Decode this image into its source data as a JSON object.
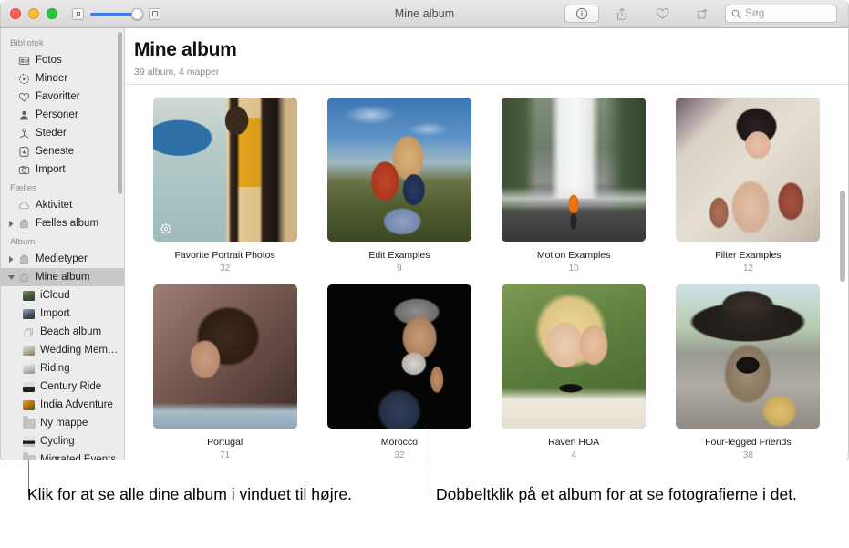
{
  "window": {
    "title": "Mine album",
    "zoom_slider_value": 100,
    "toolbar": {
      "info_label": "info-button",
      "share_label": "share-button",
      "favorite_label": "favorite-button",
      "rotate_label": "rotate-button",
      "search_placeholder": "Søg",
      "search_value": ""
    }
  },
  "sidebar": {
    "sections": [
      {
        "header": "Bibliotek",
        "items": [
          {
            "label": "Fotos",
            "icon": "photos-icon",
            "level": 0,
            "twisty": "none",
            "selected": false
          },
          {
            "label": "Minder",
            "icon": "memories-icon",
            "level": 0,
            "twisty": "none",
            "selected": false
          },
          {
            "label": "Favoritter",
            "icon": "heart-icon",
            "level": 0,
            "twisty": "none",
            "selected": false
          },
          {
            "label": "Personer",
            "icon": "person-icon",
            "level": 0,
            "twisty": "none",
            "selected": false
          },
          {
            "label": "Steder",
            "icon": "places-icon",
            "level": 0,
            "twisty": "none",
            "selected": false
          },
          {
            "label": "Seneste",
            "icon": "recents-icon",
            "level": 0,
            "twisty": "none",
            "selected": false
          },
          {
            "label": "Import",
            "icon": "import-icon",
            "level": 0,
            "twisty": "none",
            "selected": false
          }
        ]
      },
      {
        "header": "Fælles",
        "items": [
          {
            "label": "Aktivitet",
            "icon": "cloud-icon",
            "level": 0,
            "twisty": "none",
            "selected": false
          },
          {
            "label": "Fælles album",
            "icon": "album-icon",
            "level": 0,
            "twisty": "collapsed",
            "selected": false
          }
        ]
      },
      {
        "header": "Album",
        "items": [
          {
            "label": "Medietyper",
            "icon": "album-icon",
            "level": 0,
            "twisty": "collapsed",
            "selected": false
          },
          {
            "label": "Mine album",
            "icon": "album-icon",
            "level": 0,
            "twisty": "expanded",
            "selected": true
          },
          {
            "label": "iCloud",
            "icon": "thumb-icloud",
            "level": 1,
            "twisty": "none",
            "selected": false
          },
          {
            "label": "Import",
            "icon": "thumb-import",
            "level": 1,
            "twisty": "none",
            "selected": false
          },
          {
            "label": "Beach album",
            "icon": "stack-icon",
            "level": 1,
            "twisty": "none",
            "selected": false
          },
          {
            "label": "Wedding Mem…",
            "icon": "thumb-wedding",
            "level": 1,
            "twisty": "none",
            "selected": false
          },
          {
            "label": "Riding",
            "icon": "thumb-riding",
            "level": 1,
            "twisty": "none",
            "selected": false
          },
          {
            "label": "Century Ride",
            "icon": "thumb-century",
            "level": 1,
            "twisty": "none",
            "selected": false
          },
          {
            "label": "India Adventure",
            "icon": "thumb-india",
            "level": 1,
            "twisty": "none",
            "selected": false
          },
          {
            "label": "Ny mappe",
            "icon": "folder-icon",
            "level": 1,
            "twisty": "none",
            "selected": false
          },
          {
            "label": "Cycling",
            "icon": "thumb-cycling",
            "level": 1,
            "twisty": "none",
            "selected": false
          },
          {
            "label": "Migrated Events",
            "icon": "folder-icon",
            "level": 1,
            "twisty": "none",
            "selected": false
          }
        ]
      }
    ]
  },
  "main": {
    "title": "Mine album",
    "subtitle": "39 album, 4 mapper",
    "albums": [
      {
        "name": "Favorite Portrait Photos",
        "count": "32",
        "art": "art-portrait-boat",
        "badge": "gear-icon"
      },
      {
        "name": "Edit Examples",
        "count": "9",
        "art": "art-field-woman",
        "badge": null
      },
      {
        "name": "Motion Examples",
        "count": "10",
        "art": "art-waterfall",
        "badge": null
      },
      {
        "name": "Filter Examples",
        "count": "12",
        "art": "art-tattoo-woman",
        "badge": null
      },
      {
        "name": "Portugal",
        "count": "71",
        "art": "art-curly-woman",
        "badge": null
      },
      {
        "name": "Morocco",
        "count": "32",
        "art": "art-old-man",
        "badge": null
      },
      {
        "name": "Raven HOA",
        "count": "4",
        "art": "art-blonde-woman",
        "badge": null
      },
      {
        "name": "Four-legged Friends",
        "count": "38",
        "art": "art-dog-hat",
        "badge": null
      }
    ]
  },
  "callouts": [
    {
      "text": "Klik for at se alle dine album i vinduet til højre."
    },
    {
      "text": "Dobbeltklik på et album for at se fotografierne i det."
    }
  ],
  "colors": {
    "accent": "#3b7dea",
    "sidebar_bg": "#ececec",
    "selection": "#c8c8c8"
  }
}
